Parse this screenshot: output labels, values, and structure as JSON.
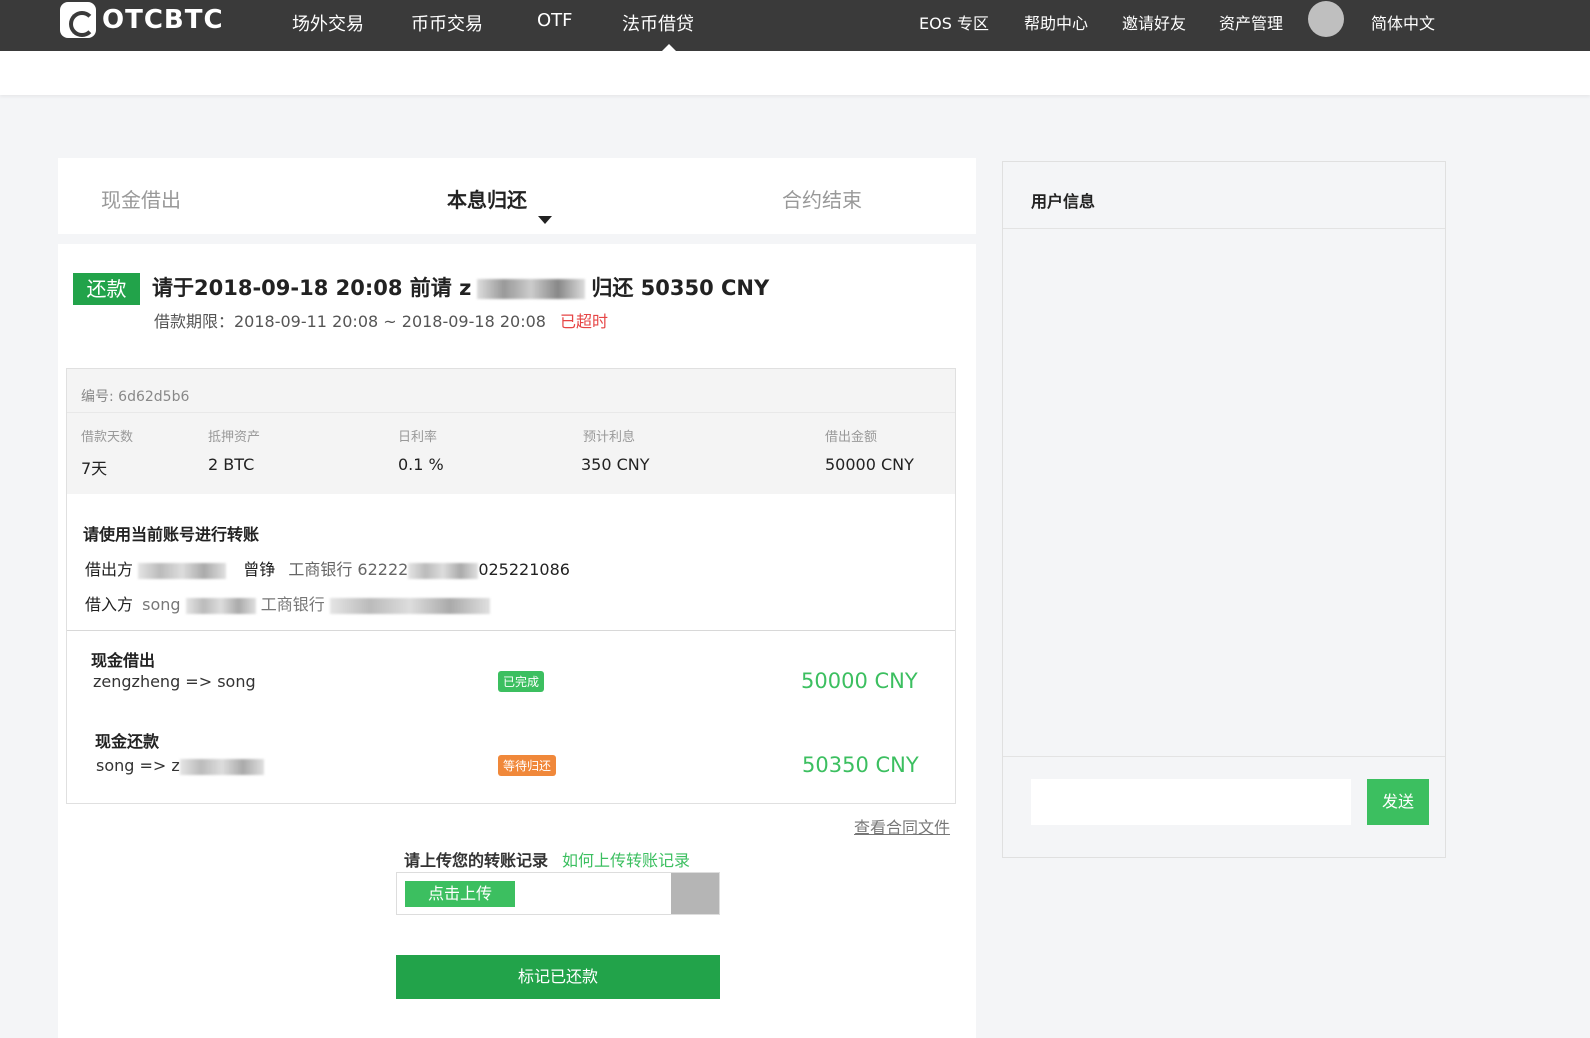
{
  "brand": {
    "name": "OTCBTC"
  },
  "nav": {
    "items": [
      "场外交易",
      "币币交易",
      "OTF",
      "法币借贷"
    ],
    "right": [
      "EOS 专区",
      "帮助中心",
      "邀请好友",
      "资产管理",
      "简体中文"
    ]
  },
  "steps": [
    "现金借出",
    "本息归还",
    "合约结束"
  ],
  "repay": {
    "tag": "还款",
    "headline_prefix": "请于2018-09-18 20:08 前请 z",
    "headline_suffix": "归还 50350 CNY",
    "period": "借款期限：2018-09-11 20:08 ~ 2018-09-18 20:08",
    "overdue": "已超时"
  },
  "order": {
    "number": "编号: 6d62d5b6",
    "columns": [
      {
        "label": "借款天数",
        "value": "7天"
      },
      {
        "label": "抵押资产",
        "value": "2 BTC"
      },
      {
        "label": "日利率",
        "value": "0.1 %"
      },
      {
        "label": "预计利息",
        "value": "350 CNY"
      },
      {
        "label": "借出金额",
        "value": "50000 CNY"
      }
    ]
  },
  "transfer": {
    "title": "请使用当前账号进行转账",
    "lender_label": "借出方",
    "lender_name": "曾铮",
    "lender_bank": "工商银行 62222",
    "lender_tail": "025221086",
    "borrower_label": "借入方",
    "borrower_prefix": "song",
    "borrower_bank": "工商银行"
  },
  "flows": [
    {
      "title": "现金借出",
      "from_to": "zengzheng => song",
      "status": "已完成",
      "amount": "50000 CNY"
    },
    {
      "title": "现金还款",
      "from_to": "song => z",
      "status": "等待归还",
      "amount": "50350 CNY"
    }
  ],
  "contract_link": "查看合同文件",
  "upload": {
    "label": "请上传您的转账记录",
    "help": "如何上传转账记录",
    "button": "点击上传"
  },
  "mark_paid": "标记已还款",
  "user_panel": {
    "title": "用户信息",
    "send": "发送"
  }
}
